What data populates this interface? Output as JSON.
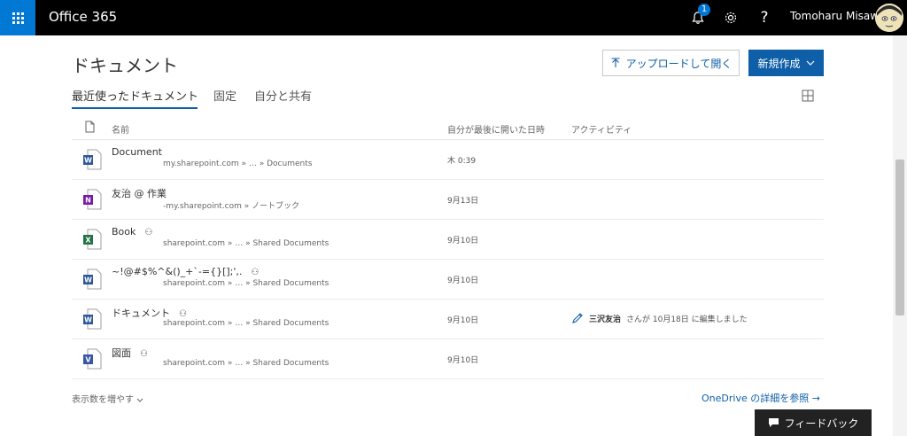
{
  "topbar": {
    "app_title": "Office 365",
    "notification_count": "1",
    "user_name": "Tomoharu Misawa",
    "icons": [
      "waffle-icon",
      "bell-icon",
      "gear-icon",
      "help-icon"
    ]
  },
  "page": {
    "title": "ドキュメント",
    "upload_label": "アップロードして開く",
    "new_label": "新規作成"
  },
  "tabs": [
    {
      "label": "最近使ったドキュメント",
      "active": true
    },
    {
      "label": "固定",
      "active": false
    },
    {
      "label": "自分と共有",
      "active": false
    }
  ],
  "columns": {
    "name": "名前",
    "last_opened": "自分が最後に開いた日時",
    "activity": "アクティビティ"
  },
  "files": [
    {
      "name": "Document",
      "path": "my.sharepoint.com » … » Documents",
      "date": "木 0:39",
      "type": "word",
      "shared": false
    },
    {
      "name": "友治 @ 作業",
      "path": "-my.sharepoint.com » ノートブック",
      "date": "9月13日",
      "type": "onenote",
      "shared": false
    },
    {
      "name": "Book",
      "path": "sharepoint.com » … » Shared Documents",
      "date": "9月10日",
      "type": "excel",
      "shared": true
    },
    {
      "name": "~!@#$%^&()_+`-={}[];',.",
      "path": "sharepoint.com » … » Shared Documents",
      "date": "9月10日",
      "type": "word",
      "shared": true
    },
    {
      "name": "ドキュメント",
      "path": "sharepoint.com » … » Shared Documents",
      "date": "9月10日",
      "type": "word",
      "shared": true,
      "activity": {
        "user": "三沢友治",
        "text": "さんが 10月18日 に編集しました"
      }
    },
    {
      "name": "図面",
      "path": "sharepoint.com » … » Shared Documents",
      "date": "9月10日",
      "type": "visio",
      "shared": true
    }
  ],
  "footer": {
    "more_label": "表示数を増やす",
    "onedrive_link": "OneDrive の詳細を参照",
    "feedback_label": "フィードバック"
  },
  "colors": {
    "brand": "#0078d4",
    "link": "#0f5ea8",
    "word": "#2b579a",
    "excel": "#217346",
    "onenote": "#7719aa",
    "visio": "#3955a3"
  }
}
